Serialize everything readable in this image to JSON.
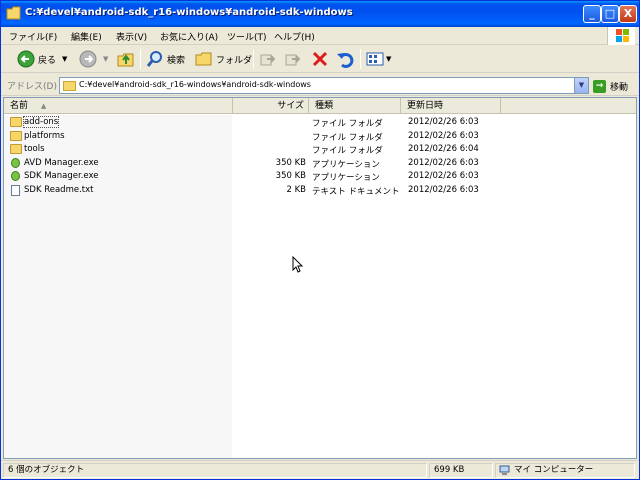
{
  "window": {
    "title": "C:¥devel¥android-sdk_r16-windows¥android-sdk-windows"
  },
  "title_buttons": {
    "minimize": "_",
    "maximize": "□",
    "close": "X"
  },
  "menu": [
    "ファイル(F)",
    "編集(E)",
    "表示(V)",
    "お気に入り(A)",
    "ツール(T)",
    "ヘルプ(H)"
  ],
  "toolbar": {
    "back_label": "戻る",
    "search_label": "検索",
    "folders_label": "フォルダ"
  },
  "address": {
    "label": "アドレス(D)",
    "value": "C:¥devel¥android-sdk_r16-windows¥android-sdk-windows",
    "go_label": "移動"
  },
  "columns": {
    "name": "名前",
    "size": "サイズ",
    "type": "種類",
    "modified": "更新日時"
  },
  "files": [
    {
      "name": "add-ons",
      "size": "",
      "type": "ファイル フォルダ",
      "modified": "2012/02/26 6:03",
      "icon": "folder-icon"
    },
    {
      "name": "platforms",
      "size": "",
      "type": "ファイル フォルダ",
      "modified": "2012/02/26 6:03",
      "icon": "folder-icon"
    },
    {
      "name": "tools",
      "size": "",
      "type": "ファイル フォルダ",
      "modified": "2012/02/26 6:04",
      "icon": "folder-icon"
    },
    {
      "name": "AVD Manager.exe",
      "size": "350 KB",
      "type": "アプリケーション",
      "modified": "2012/02/26 6:03",
      "icon": "android-exe-icon"
    },
    {
      "name": "SDK Manager.exe",
      "size": "350 KB",
      "type": "アプリケーション",
      "modified": "2012/02/26 6:03",
      "icon": "android-exe-icon"
    },
    {
      "name": "SDK Readme.txt",
      "size": "2 KB",
      "type": "テキスト ドキュメント",
      "modified": "2012/02/26 6:03",
      "icon": "text-document-icon"
    }
  ],
  "status": {
    "objects": "6 個のオブジェクト",
    "size": "699 KB",
    "location": "マイ コンピューター"
  }
}
